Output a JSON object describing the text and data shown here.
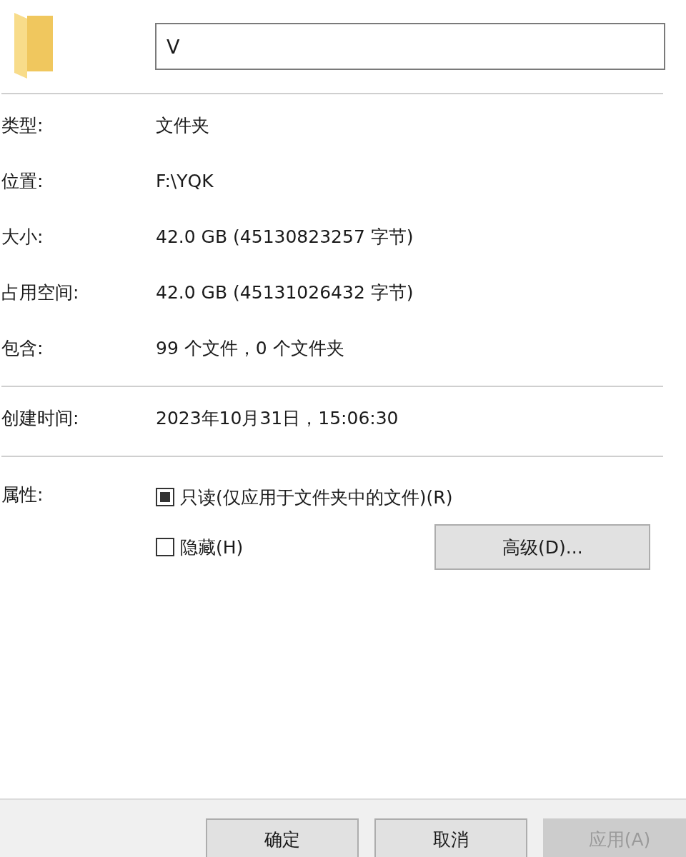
{
  "name_field": {
    "value": "V"
  },
  "general": [
    {
      "label": "类型:",
      "value": "文件夹"
    },
    {
      "label": "位置:",
      "value": "F:\\YQK"
    },
    {
      "label": "大小:",
      "value": "42.0 GB (45130823257 字节)"
    },
    {
      "label": "占用空间:",
      "value": "42.0 GB (45131026432 字节)"
    },
    {
      "label": "包含:",
      "value": "99 个文件，0 个文件夹"
    }
  ],
  "dates": [
    {
      "label": "创建时间:",
      "value": "2023年10月31日，15:06:30"
    }
  ],
  "attributes": {
    "label": "属性:",
    "checkboxes": [
      {
        "label": "只读(仅应用于文件夹中的文件)(R)",
        "indeterminate": true
      },
      {
        "label": "隐藏(H)",
        "indeterminate": false
      }
    ],
    "advanced_button": "高级(D)..."
  },
  "buttons": [
    {
      "label": "确定",
      "disabled": false
    },
    {
      "label": "取消",
      "disabled": false
    },
    {
      "label": "应用(A)",
      "disabled": true
    }
  ]
}
